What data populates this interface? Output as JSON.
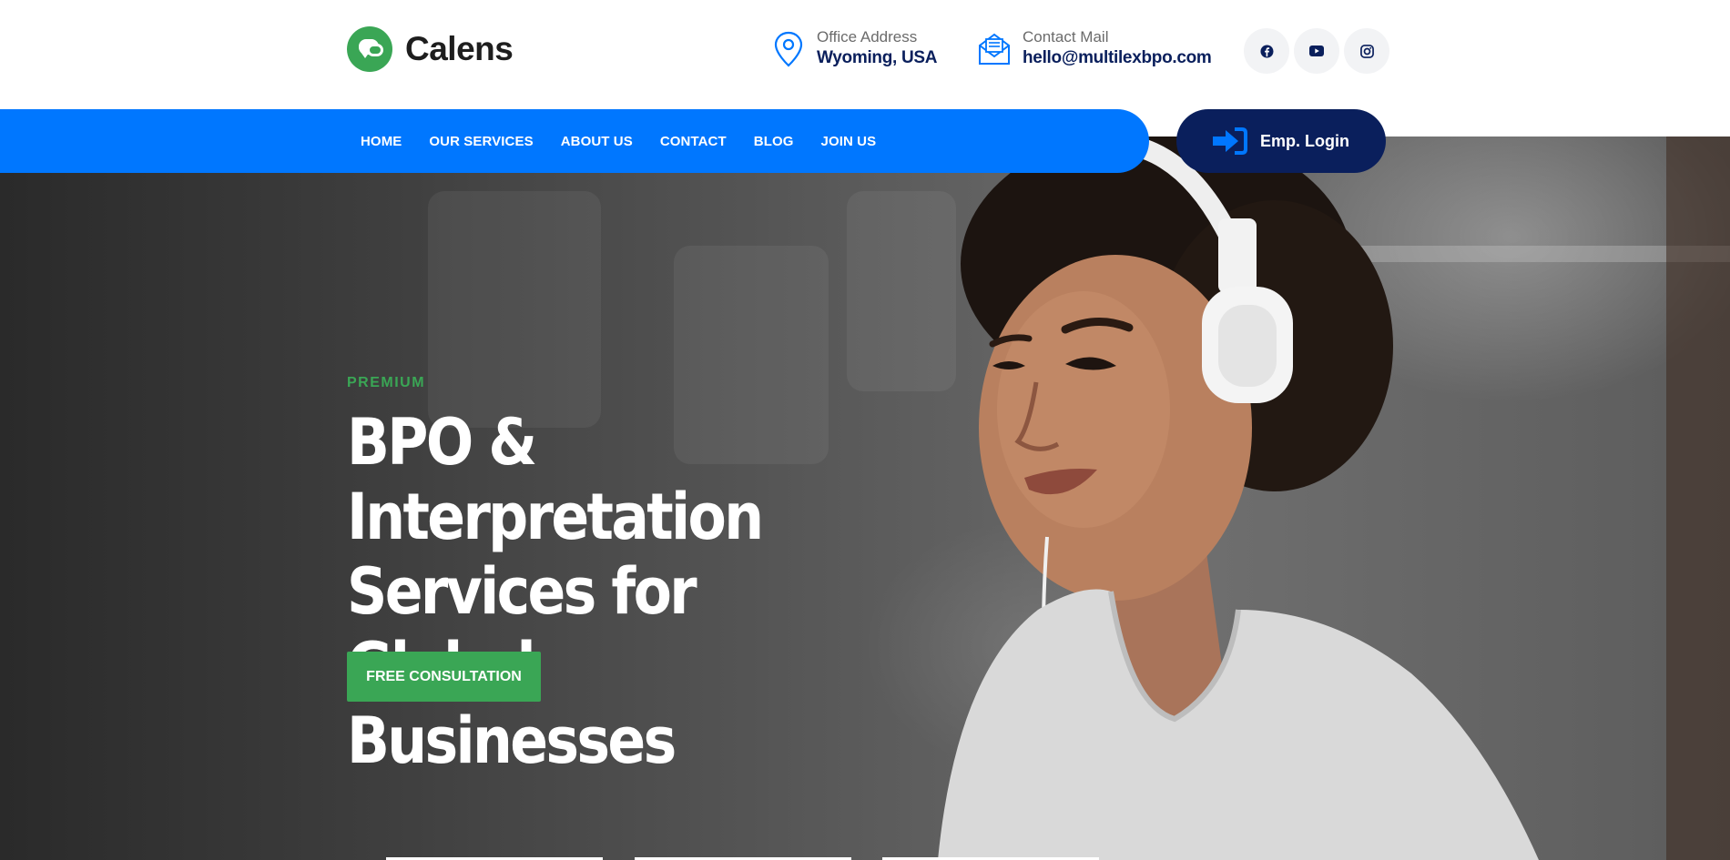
{
  "brand": {
    "name": "Calens",
    "accent": "#3aa655",
    "primary": "#0077ff",
    "navy": "#0a1f5c"
  },
  "header": {
    "office": {
      "label": "Office Address",
      "value": "Wyoming, USA",
      "icon": "map-pin-icon"
    },
    "mail": {
      "label": "Contact Mail",
      "value": "hello@multilexbpo.com",
      "icon": "envelope-icon"
    },
    "social": [
      "facebook-icon",
      "youtube-icon",
      "instagram-icon"
    ]
  },
  "nav": {
    "items": [
      "HOME",
      "OUR SERVICES",
      "ABOUT US",
      "CONTACT",
      "BLOG",
      "JOIN US"
    ],
    "login_label": "Emp. Login"
  },
  "hero": {
    "tag": "PREMIUM",
    "title_line1": "BPO & Interpretation",
    "title_line2": "Services for Global",
    "title_line3": "Businesses",
    "cta_label": "FREE CONSULTATION"
  }
}
